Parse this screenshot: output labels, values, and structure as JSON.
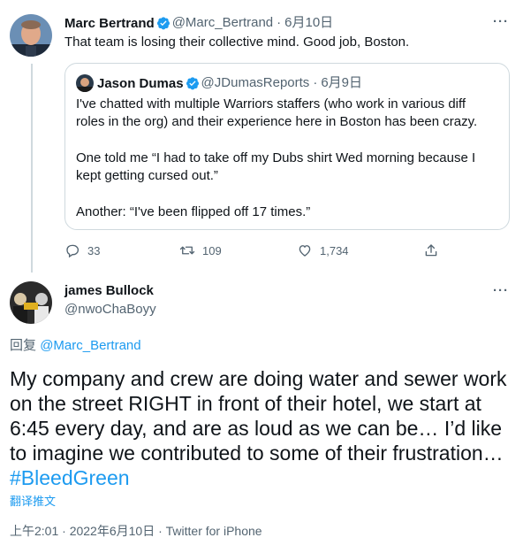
{
  "tweet1": {
    "name": "Marc Bertrand",
    "handle": "@Marc_Bertrand",
    "sep": "·",
    "date": "6月10日",
    "text": "That team is losing their collective mind. Good job, Boston.",
    "quote": {
      "name": "Jason Dumas",
      "handle": "@JDumasReports",
      "sep": "·",
      "date": "6月9日",
      "para1": "I've chatted with multiple Warriors staffers (who work in various diff roles in the org) and their experience here in Boston has been crazy.",
      "para2": "One told me “I had to take off my Dubs shirt Wed morning because I kept getting cursed out.”",
      "para3": "Another: “I've been flipped off 17 times.”"
    },
    "actions": {
      "replies": "33",
      "retweets": "109",
      "likes": "1,734"
    }
  },
  "tweet2": {
    "name": "james Bullock",
    "handle": "@nwoChaBoyy",
    "reply_prefix": "回复",
    "reply_to": "@Marc_Bertrand",
    "text": "My company and crew are doing water and sewer work on the street RIGHT in front of their hotel, we start at 6:45 every day, and are as loud as we can be… I’d like to imagine we contributed to some of their frustration…",
    "hashtag": "#BleedGreen",
    "translate": "翻译推文",
    "timestamp": "上午2:01 · 2022年6月10日 · Twitter for iPhone"
  },
  "more_glyph": "···",
  "colors": {
    "accent": "#1d9bf0",
    "muted": "#536471",
    "border": "#cfd9de"
  },
  "icons": [
    "verified-badge-icon",
    "reply-icon",
    "retweet-icon",
    "like-icon",
    "share-icon",
    "more-icon"
  ]
}
